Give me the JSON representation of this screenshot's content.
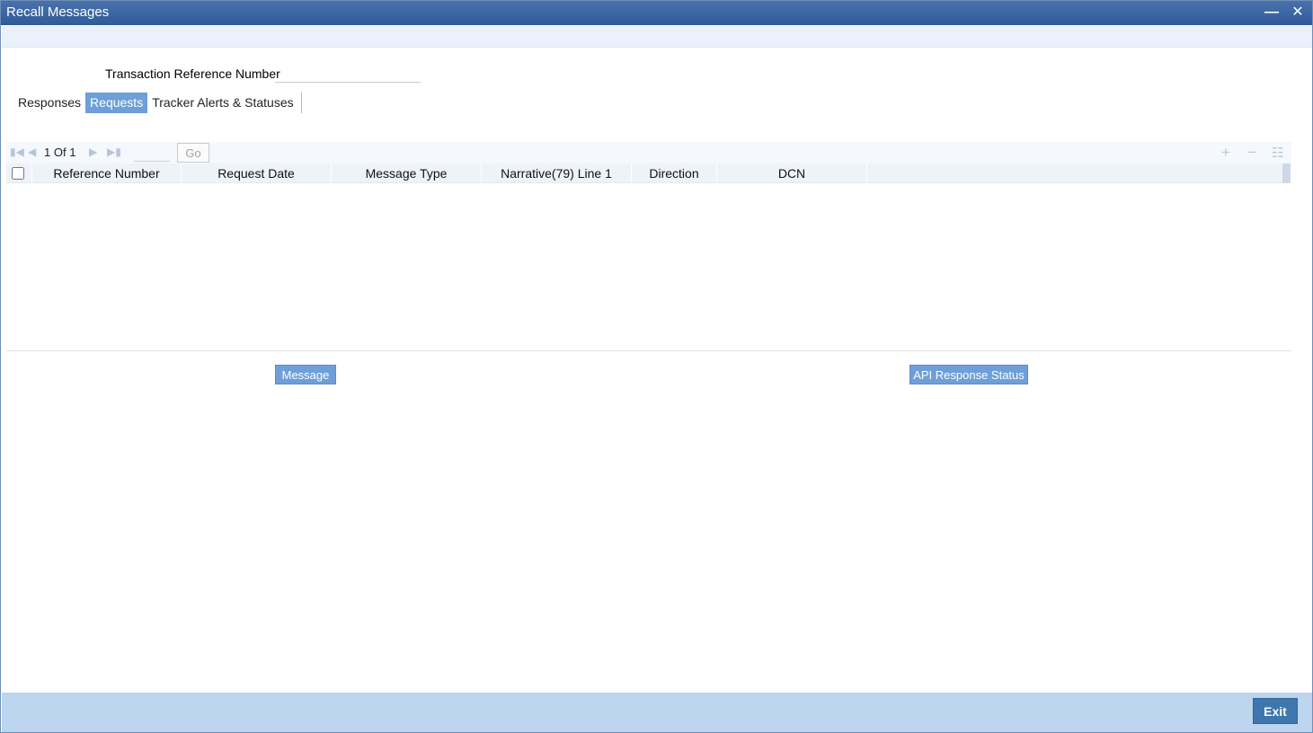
{
  "window": {
    "title": "Recall Messages"
  },
  "form": {
    "trn_label": "Transaction Reference Number",
    "trn_value": ""
  },
  "tabs": [
    {
      "label": "Responses",
      "active": false
    },
    {
      "label": "Requests",
      "active": true
    },
    {
      "label": "Tracker Alerts & Statuses",
      "active": false
    }
  ],
  "grid": {
    "pagination": {
      "current": "1",
      "of_label": "Of",
      "total": "1",
      "go_label": "Go",
      "page_input": ""
    },
    "columns": [
      "Reference Number",
      "Request Date",
      "Message Type",
      "Narrative(79) Line 1",
      "Direction",
      "DCN"
    ],
    "rows": []
  },
  "buttons": {
    "message": "Message",
    "api_response_status": "API Response Status",
    "exit": "Exit"
  },
  "colors": {
    "titlebar": "#2f5b99",
    "active_tab": "#6e9fd8",
    "footer": "#bdd5ee",
    "exit_button": "#3d77ad"
  }
}
